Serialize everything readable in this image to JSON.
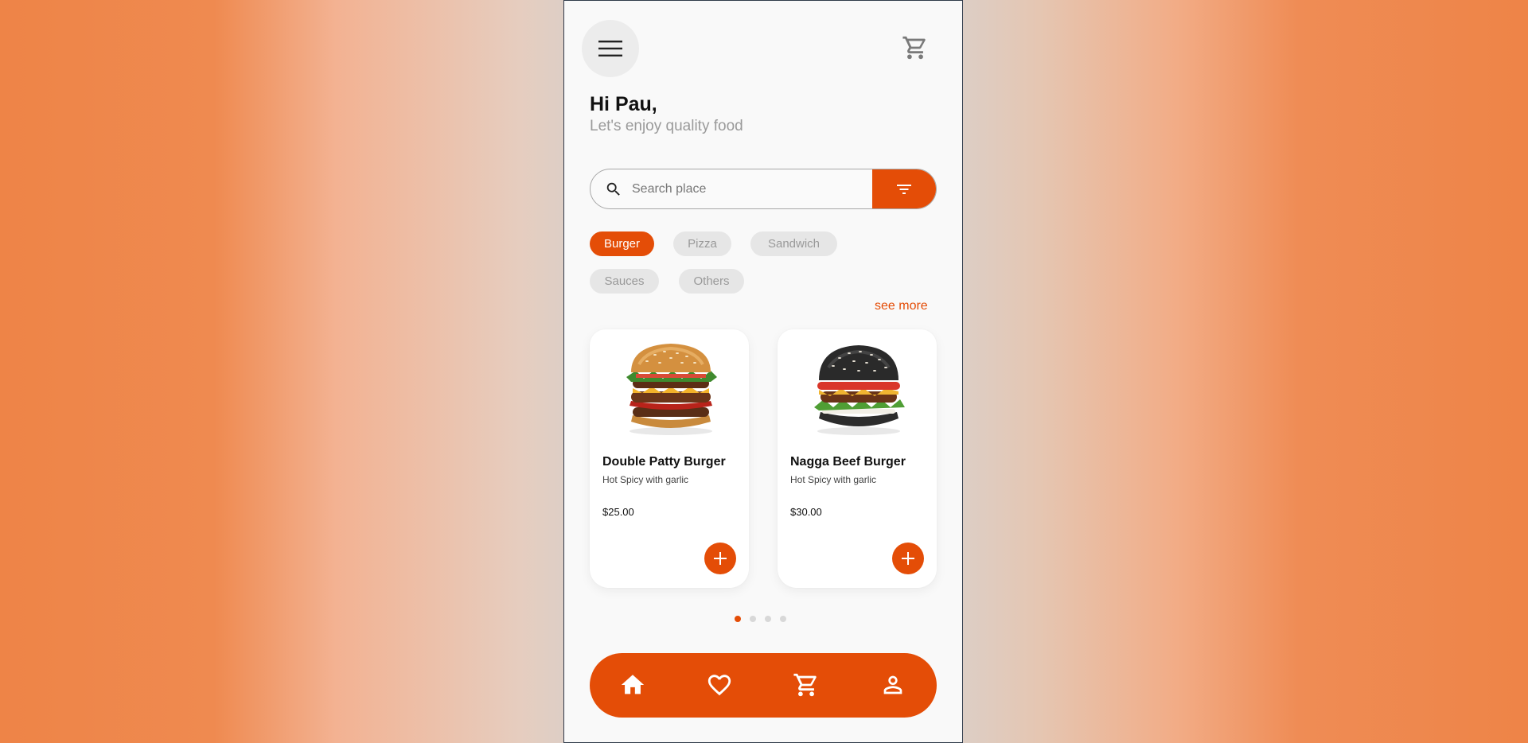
{
  "header": {
    "greeting": "Hi Pau,",
    "subtitle": "Let's enjoy quality food"
  },
  "search": {
    "placeholder": "Search place",
    "value": ""
  },
  "categories": [
    {
      "label": "Burger",
      "active": true
    },
    {
      "label": "Pizza",
      "active": false
    },
    {
      "label": "Sandwich",
      "active": false
    },
    {
      "label": "Sauces",
      "active": false
    },
    {
      "label": "Others",
      "active": false
    }
  ],
  "see_more_label": "see more",
  "products": [
    {
      "name": "Double Patty Burger",
      "description": "Hot Spicy with garlic",
      "price": "$25.00",
      "bun": "sesame-bun"
    },
    {
      "name": "Nagga Beef Burger",
      "description": "Hot Spicy with garlic",
      "price": "$30.00",
      "bun": "black-bun"
    }
  ],
  "carousel": {
    "pages": 4,
    "active_page": 1
  },
  "bottom_nav": [
    {
      "name": "home",
      "icon": "home-icon"
    },
    {
      "name": "favorites",
      "icon": "heart-icon"
    },
    {
      "name": "cart",
      "icon": "cart-icon"
    },
    {
      "name": "profile",
      "icon": "user-icon"
    }
  ],
  "colors": {
    "accent": "#e44d07",
    "chip_inactive_bg": "#e6e6e6",
    "chip_inactive_text": "#999999",
    "screen_bg": "#f9f9f9"
  }
}
